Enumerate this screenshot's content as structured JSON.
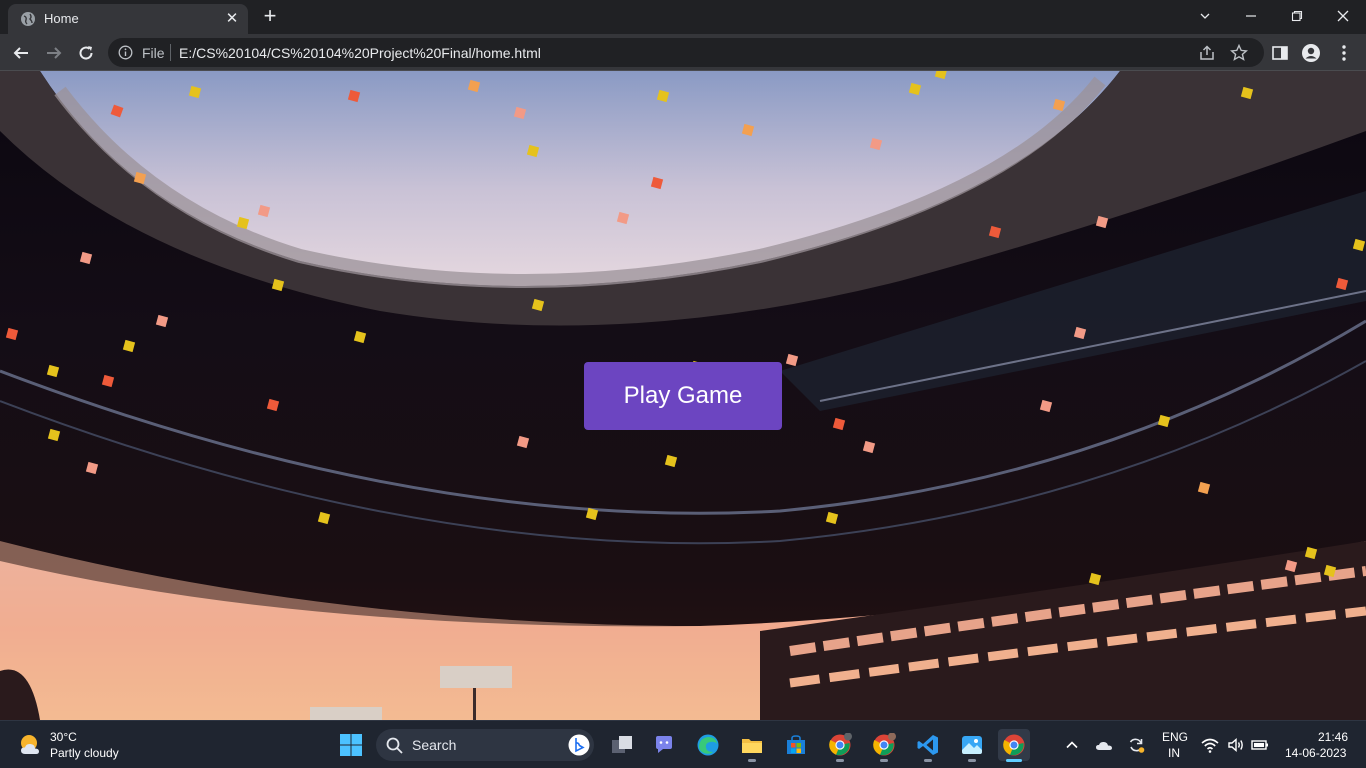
{
  "browser": {
    "tab_title": "Home",
    "close_tab_glyph": "✕",
    "new_tab_glyph": "+",
    "scheme_label": "File",
    "url": "E:/CS%20104/CS%20104%20Project%20Final/home.html"
  },
  "page": {
    "play_button_label": "Play Game",
    "background_description": "stadium",
    "colors": {
      "button": "#6c45c1"
    }
  },
  "taskbar": {
    "weather_temp": "30°C",
    "weather_desc": "Partly cloudy",
    "search_label": "Search",
    "language_line1": "ENG",
    "language_line2": "IN",
    "time": "21:46",
    "date": "14-06-2023"
  }
}
